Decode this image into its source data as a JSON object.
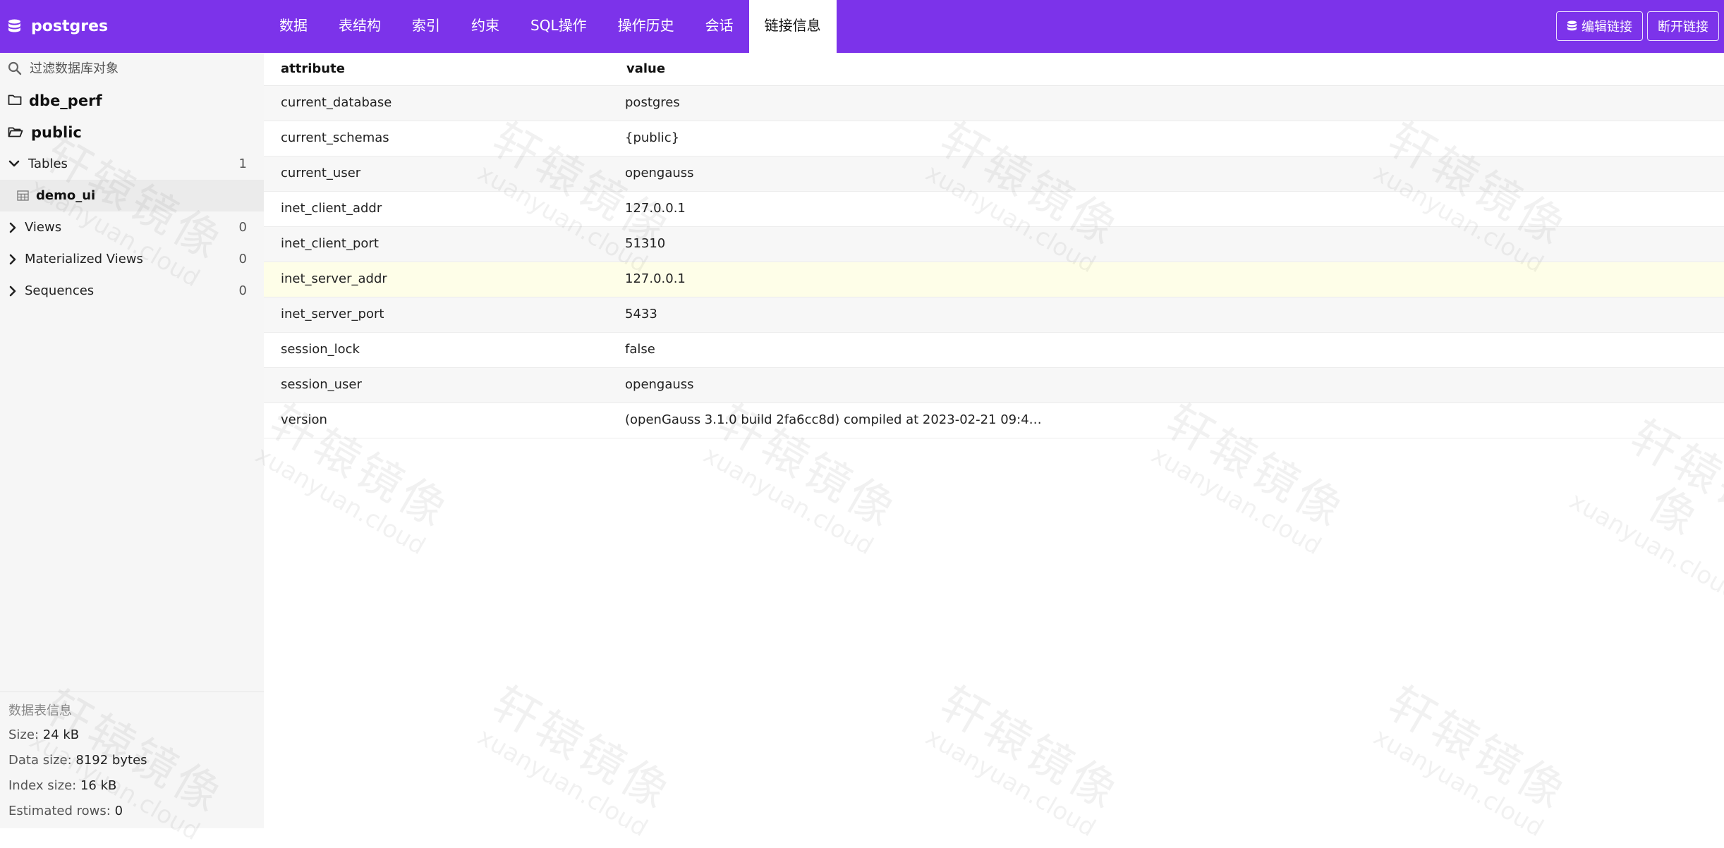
{
  "app": {
    "db_name": "postgres",
    "accent": "#7c33ea"
  },
  "tabs": [
    {
      "label": "数据"
    },
    {
      "label": "表结构"
    },
    {
      "label": "索引"
    },
    {
      "label": "约束"
    },
    {
      "label": "SQL操作"
    },
    {
      "label": "操作历史"
    },
    {
      "label": "会话"
    },
    {
      "label": "链接信息",
      "active": true
    }
  ],
  "actions": {
    "edit_label": "编辑链接",
    "disconnect_label": "断开链接"
  },
  "sidebar": {
    "search_placeholder": "过滤数据库对象",
    "schemas": [
      {
        "name": "dbe_perf",
        "icon": "folder-icon"
      },
      {
        "name": "public",
        "icon": "folder-open-icon"
      }
    ],
    "groups": [
      {
        "label": "Tables",
        "count": "1",
        "expanded": true
      },
      {
        "label": "Views",
        "count": "0"
      },
      {
        "label": "Materialized Views",
        "count": "0"
      },
      {
        "label": "Sequences",
        "count": "0"
      }
    ],
    "selected_table": "demo_ui"
  },
  "table_info": {
    "title": "数据表信息",
    "size_label": "Size:",
    "size_value": "24 kB",
    "data_size_label": "Data size:",
    "data_size_value": "8192 bytes",
    "index_size_label": "Index size:",
    "index_size_value": "16 kB",
    "rows_label": "Estimated rows:",
    "rows_value": "0"
  },
  "connection_info": {
    "headers": [
      "attribute",
      "value"
    ],
    "rows": [
      {
        "attribute": "current_database",
        "value": "postgres"
      },
      {
        "attribute": "current_schemas",
        "value": "{public}"
      },
      {
        "attribute": "current_user",
        "value": "opengauss"
      },
      {
        "attribute": "inet_client_addr",
        "value": "127.0.0.1"
      },
      {
        "attribute": "inet_client_port",
        "value": "51310"
      },
      {
        "attribute": "inet_server_addr",
        "value": "127.0.0.1"
      },
      {
        "attribute": "inet_server_port",
        "value": "5433"
      },
      {
        "attribute": "session_lock",
        "value": "false"
      },
      {
        "attribute": "session_user",
        "value": "opengauss"
      },
      {
        "attribute": "version",
        "value": "(openGauss 3.1.0 build 2fa6cc8d) compiled at 2023-02-21 09:4…"
      }
    ]
  },
  "watermark": {
    "text": "轩辕镜像",
    "sub": "xuanyuan.cloud"
  }
}
